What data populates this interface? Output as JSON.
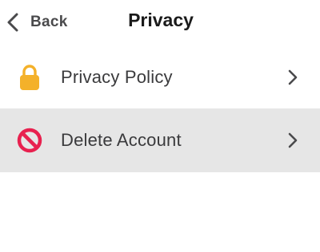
{
  "nav": {
    "back_label": "Back",
    "title": "Privacy"
  },
  "list": {
    "items": [
      {
        "label": "Privacy Policy",
        "icon": "lock-icon",
        "icon_color": "#f4b12a"
      },
      {
        "label": "Delete Account",
        "icon": "prohibited-icon",
        "icon_color": "#e8214f"
      }
    ]
  },
  "colors": {
    "background": "#ffffff",
    "highlight_row": "#e6e6e6",
    "chevron": "#4a4a4c"
  }
}
